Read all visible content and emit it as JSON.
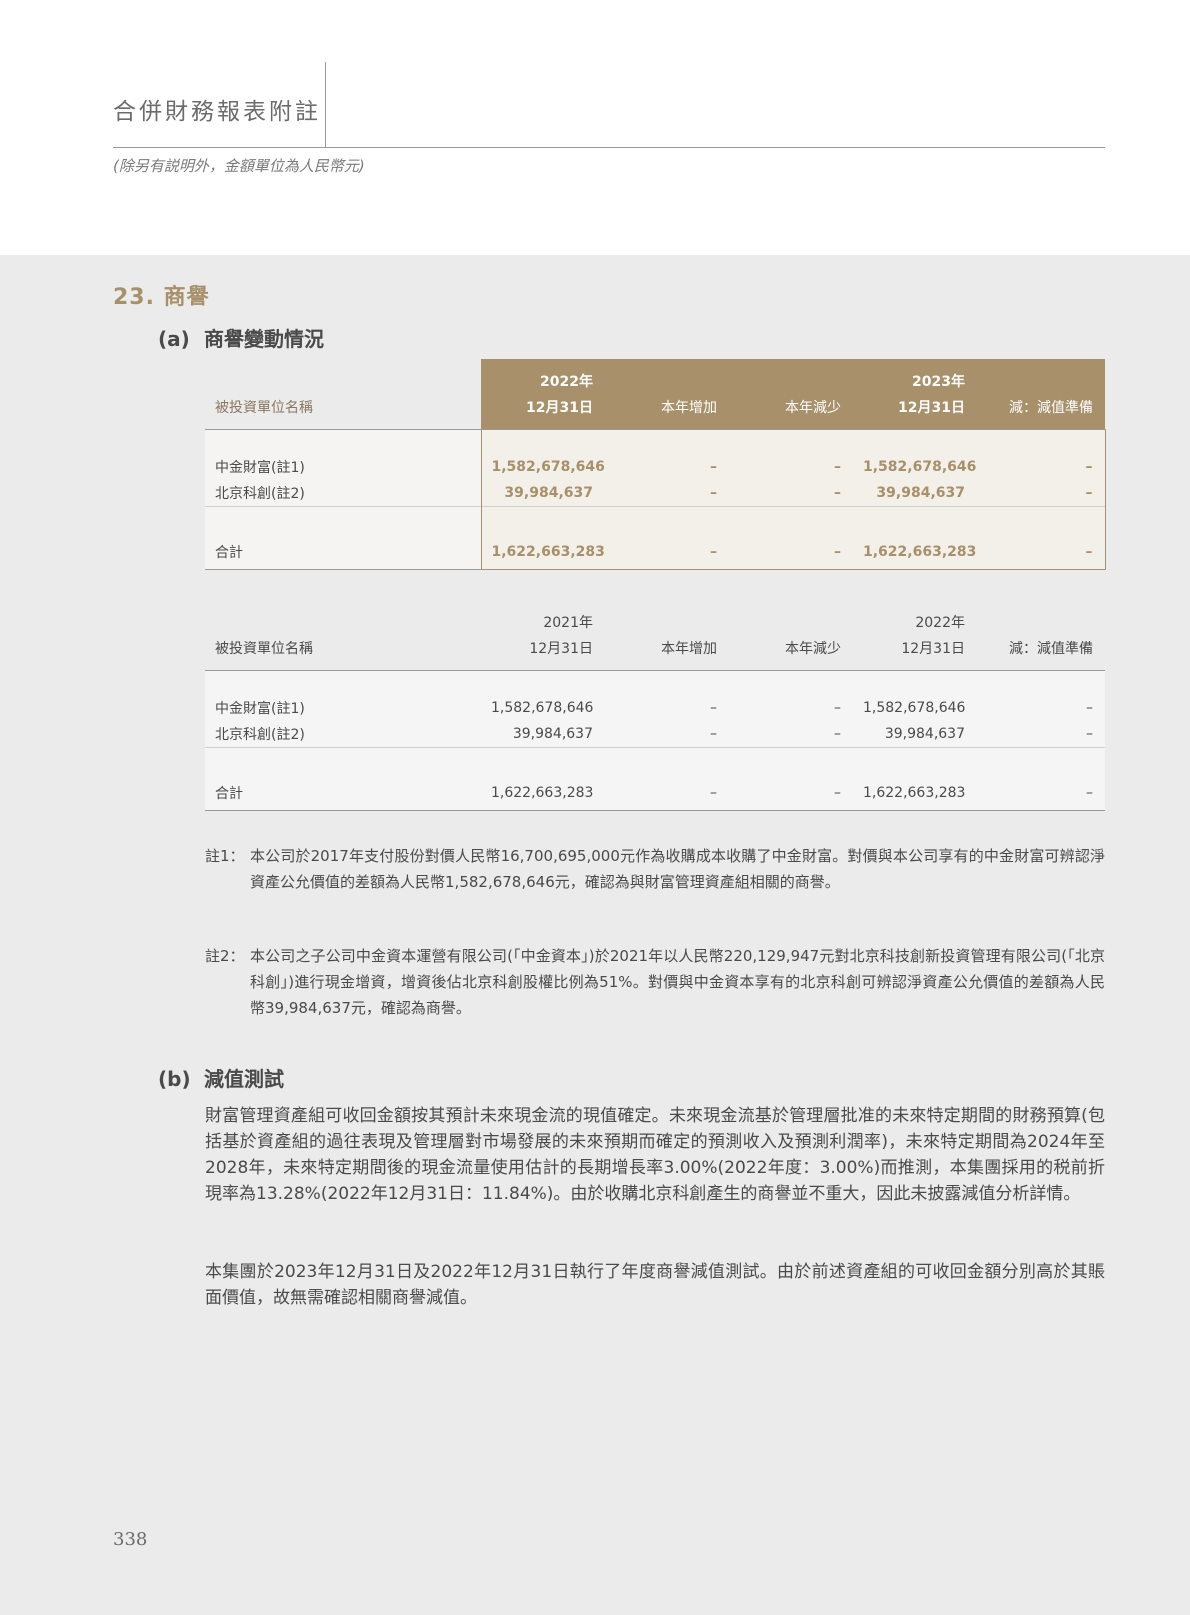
{
  "header": {
    "title": "合併財務報表附註",
    "subtitle": "(除另有説明外，金額單位為人民幣元)"
  },
  "section": {
    "title": "23. 商譽",
    "sub_a": {
      "label": "(a)",
      "title": "商譽變動情況"
    },
    "sub_b": {
      "label": "(b)",
      "title": "減值測試"
    }
  },
  "table_2023": {
    "headers": {
      "name": "被投資單位名稱",
      "open_year": "2022年",
      "open_date": "12月31日",
      "increase": "本年增加",
      "decrease": "本年減少",
      "close_year": "2023年",
      "close_date": "12月31日",
      "impairment": "減：減值準備"
    },
    "rows": [
      {
        "name": "中金財富(註1)",
        "open": "1,582,678,646",
        "increase": "–",
        "decrease": "–",
        "close": "1,582,678,646",
        "impairment": "–"
      },
      {
        "name": "北京科創(註2)",
        "open": "39,984,637",
        "increase": "–",
        "decrease": "–",
        "close": "39,984,637",
        "impairment": "–"
      }
    ],
    "total": {
      "name": "合計",
      "open": "1,622,663,283",
      "increase": "–",
      "decrease": "–",
      "close": "1,622,663,283",
      "impairment": "–"
    }
  },
  "table_2022": {
    "headers": {
      "name": "被投資單位名稱",
      "open_year": "2021年",
      "open_date": "12月31日",
      "increase": "本年增加",
      "decrease": "本年減少",
      "close_year": "2022年",
      "close_date": "12月31日",
      "impairment": "減：減值準備"
    },
    "rows": [
      {
        "name": "中金財富(註1)",
        "open": "1,582,678,646",
        "increase": "–",
        "decrease": "–",
        "close": "1,582,678,646",
        "impairment": "–"
      },
      {
        "name": "北京科創(註2)",
        "open": "39,984,637",
        "increase": "–",
        "decrease": "–",
        "close": "39,984,637",
        "impairment": "–"
      }
    ],
    "total": {
      "name": "合計",
      "open": "1,622,663,283",
      "increase": "–",
      "decrease": "–",
      "close": "1,622,663,283",
      "impairment": "–"
    }
  },
  "notes": [
    {
      "label": "註1：",
      "text": "本公司於2017年支付股份對價人民幣16,700,695,000元作為收購成本收購了中金財富。對價與本公司享有的中金財富可辨認淨資產公允價值的差額為人民幣1,582,678,646元，確認為與財富管理資產組相關的商譽。"
    },
    {
      "label": "註2：",
      "text": "本公司之子公司中金資本運營有限公司(「中金資本」)於2021年以人民幣220,129,947元對北京科技創新投資管理有限公司(「北京科創」)進行現金增資，增資後佔北京科創股權比例為51%。對價與中金資本享有的北京科創可辨認淨資產公允價值的差額為人民幣39,984,637元，確認為商譽。"
    }
  ],
  "impairment_paragraphs": [
    "財富管理資產組可收回金額按其預計未來現金流的現值確定。未來現金流基於管理層批准的未來特定期間的財務預算(包括基於資產組的過往表現及管理層對市場發展的未來預期而確定的預測收入及預測利潤率)，未來特定期間為2024年至2028年，未來特定期間後的現金流量使用估計的長期增長率3.00%(2022年度：3.00%)而推測，本集團採用的税前折現率為13.28%(2022年12月31日：11.84%)。由於收購北京科創產生的商譽並不重大，因此未披露減值分析詳情。",
    "本集團於2023年12月31日及2022年12月31日執行了年度商譽減值測試。由於前述資產組的可收回金額分別高於其賬面價值，故無需確認相關商譽減值。"
  ],
  "page_number": "338"
}
